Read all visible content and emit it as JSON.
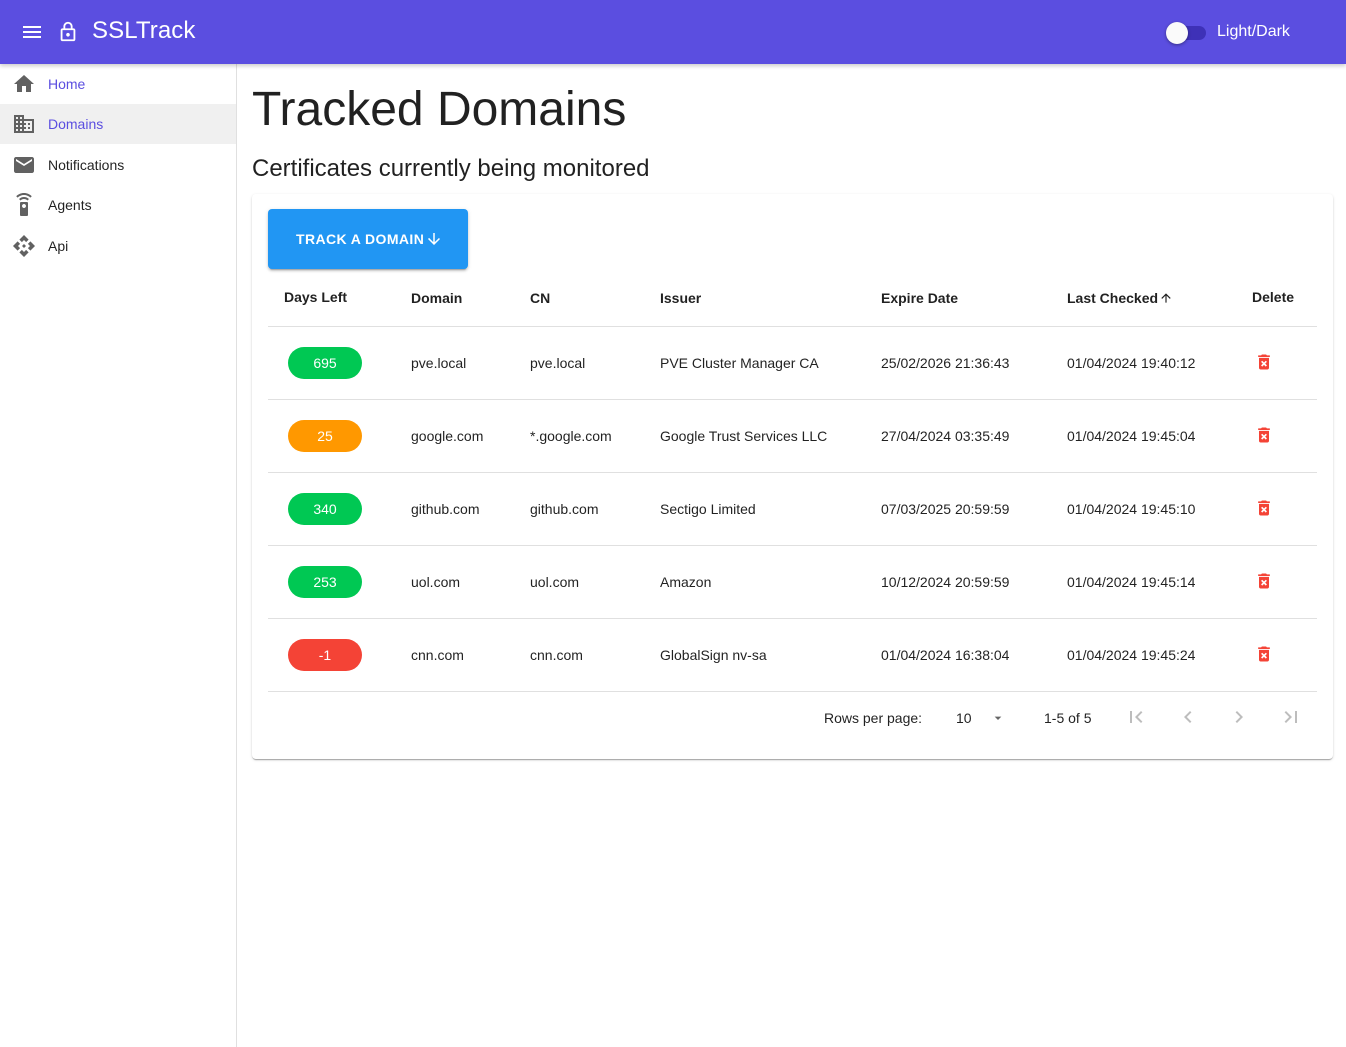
{
  "app": {
    "title": "SSLTrack",
    "theme_toggle_label": "Light/Dark",
    "theme_toggle_on": false,
    "accent_color": "#5b4ee0"
  },
  "sidebar": {
    "items": [
      {
        "label": "Home",
        "icon": "home-icon",
        "active": false
      },
      {
        "label": "Domains",
        "icon": "domain-icon",
        "active": true
      },
      {
        "label": "Notifications",
        "icon": "mail-icon",
        "active": false
      },
      {
        "label": "Agents",
        "icon": "settings-remote-icon",
        "active": false
      },
      {
        "label": "Api",
        "icon": "api-icon",
        "active": false
      }
    ]
  },
  "main": {
    "title": "Tracked Domains",
    "subtitle": "Certificates currently being monitored",
    "track_button_label": "TRACK A DOMAIN",
    "table": {
      "headers": {
        "days_left": "Days Left",
        "domain": "Domain",
        "cn": "CN",
        "issuer": "Issuer",
        "expire_date": "Expire Date",
        "last_checked": "Last Checked",
        "delete": "Delete"
      },
      "sort": {
        "column": "last_checked",
        "direction": "ascending"
      },
      "rows": [
        {
          "days_left": "695",
          "status_color": "#00c853",
          "domain": "pve.local",
          "cn": "pve.local",
          "issuer": "PVE Cluster Manager CA",
          "expire_date": "25/02/2026 21:36:43",
          "last_checked": "01/04/2024 19:40:12"
        },
        {
          "days_left": "25",
          "status_color": "#ff9800",
          "domain": "google.com",
          "cn": "*.google.com",
          "issuer": "Google Trust Services LLC",
          "expire_date": "27/04/2024 03:35:49",
          "last_checked": "01/04/2024 19:45:04"
        },
        {
          "days_left": "340",
          "status_color": "#00c853",
          "domain": "github.com",
          "cn": "github.com",
          "issuer": "Sectigo Limited",
          "expire_date": "07/03/2025 20:59:59",
          "last_checked": "01/04/2024 19:45:10"
        },
        {
          "days_left": "253",
          "status_color": "#00c853",
          "domain": "uol.com",
          "cn": "uol.com",
          "issuer": "Amazon",
          "expire_date": "10/12/2024 20:59:59",
          "last_checked": "01/04/2024 19:45:14"
        },
        {
          "days_left": "-1",
          "status_color": "#f44336",
          "domain": "cnn.com",
          "cn": "cnn.com",
          "issuer": "GlobalSign nv-sa",
          "expire_date": "01/04/2024 16:38:04",
          "last_checked": "01/04/2024 19:45:24"
        }
      ]
    },
    "pagination": {
      "rows_per_page_label": "Rows per page:",
      "rows_per_page": "10",
      "range": "1-5 of 5"
    }
  }
}
